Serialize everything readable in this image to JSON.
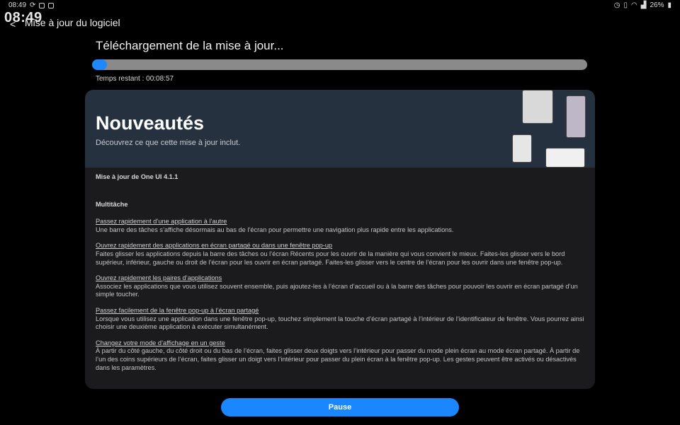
{
  "status_bar": {
    "time": "08:49",
    "battery": "26%"
  },
  "clock_overlay": "08:49",
  "header": {
    "title": "Mise à jour du logiciel"
  },
  "download": {
    "title": "Téléchargement de la mise à jour...",
    "progress_fraction": 0.03,
    "time_remaining": "Temps restant : 00:08:57"
  },
  "whats_new": {
    "title": "Nouveautés",
    "subtitle": "Découvrez ce que cette mise à jour inclut.",
    "version": "Mise à jour de One UI 4.1.1",
    "section": "Multitâche",
    "features": [
      {
        "title": "Passez rapidement d’une application à l’autre",
        "desc": "Une barre des tâches s’affiche désormais au bas de l’écran pour permettre une navigation plus rapide entre les applications."
      },
      {
        "title": "Ouvrez rapidement des applications en écran partagé ou dans une fenêtre pop-up",
        "desc": "Faites glisser les applications depuis la barre des tâches ou l’écran Récents pour les ouvrir de la manière qui vous convient le mieux. Faites-les glisser vers le bord supérieur, inférieur, gauche ou droit de l’écran pour les ouvrir en écran partagé. Faites-les glisser vers le centre de l’écran pour les ouvrir dans une fenêtre pop-up."
      },
      {
        "title": "Ouvrez rapidement les paires d’applications",
        "desc": "Associez les applications que vous utilisez souvent ensemble, puis ajoutez-les à l’écran d’accueil ou à la barre des tâches pour pouvoir les ouvrir en écran partagé d’un simple toucher."
      },
      {
        "title": "Passez facilement de la fenêtre pop-up à l’écran partagé",
        "desc": "Lorsque vous utilisez une application dans une fenêtre pop-up, touchez simplement la touche d’écran partagé à l’intérieur de l’identificateur de fenêtre. Vous pourrez ainsi choisir une deuxième application à exécuter simultanément."
      },
      {
        "title": "Changez votre mode d’affichage en un geste",
        "desc": "À partir du côté gauche, du côté droit ou du bas de l’écran, faites glisser deux doigts vers l’intérieur pour passer du mode plein écran au mode écran partagé. À partir de l’un des coins supérieurs de l’écran, faites glisser un doigt vers l’intérieur pour passer du plein écran à la fenêtre pop-up. Les gestes peuvent être activés ou désactivés dans les paramètres."
      }
    ]
  },
  "pause_label": "Pause",
  "colors": {
    "accent": "#1a87ff",
    "banner": "#26313f",
    "card": "#1b1b1d"
  }
}
